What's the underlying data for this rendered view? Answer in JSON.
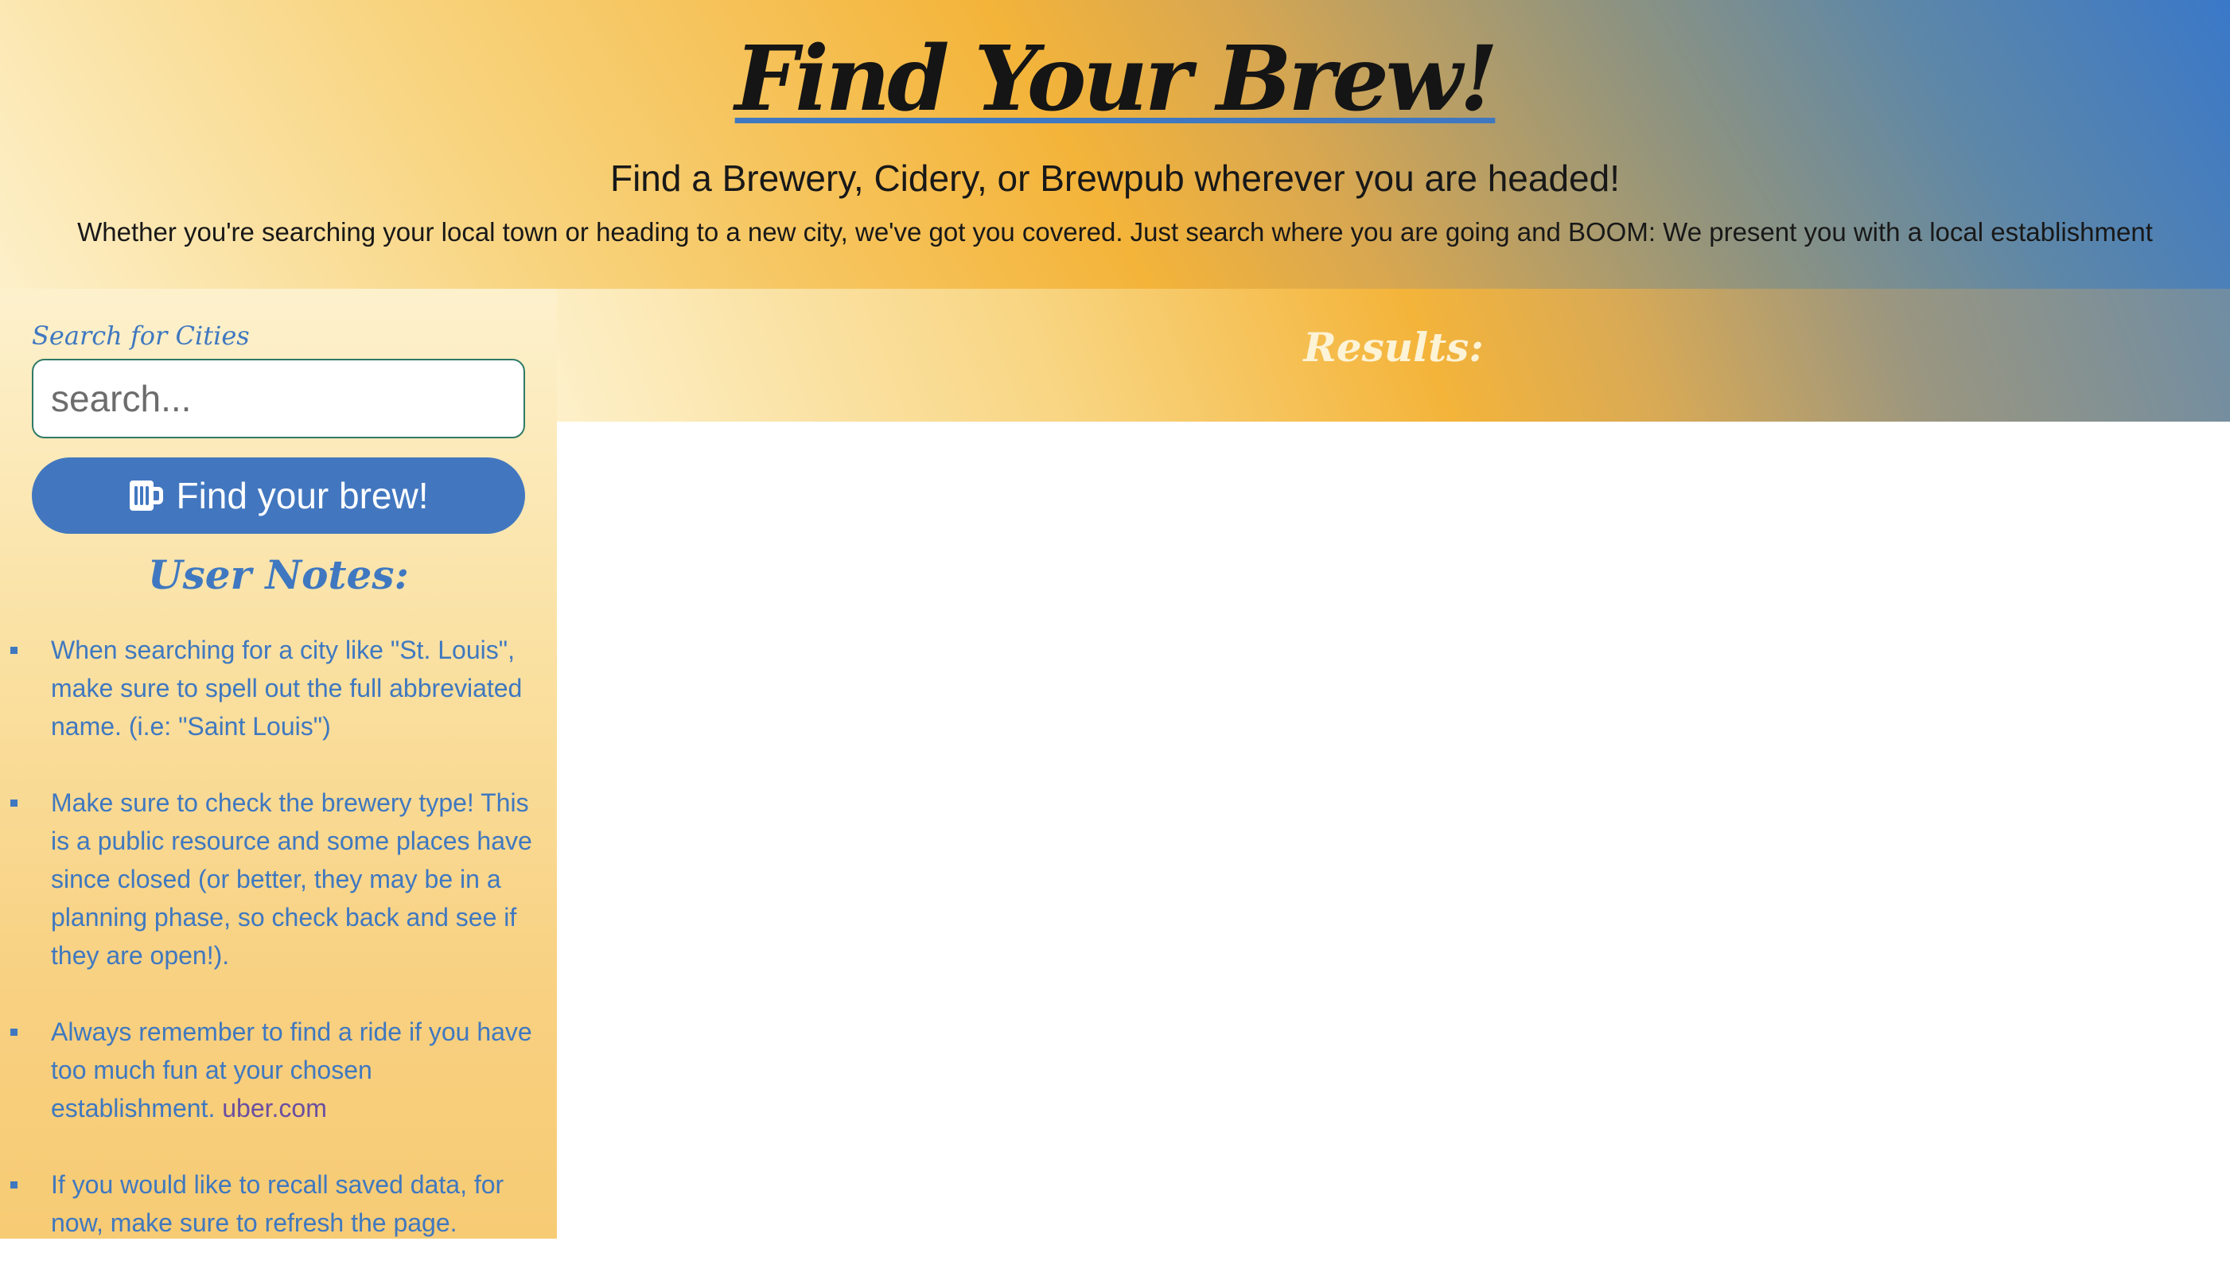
{
  "header": {
    "title": "Find Your Brew!",
    "subtitle": "Find a Brewery, Cidery, or Brewpub wherever you are headed!",
    "tagline": "Whether you're searching your local town or heading to a new city, we've got you covered. Just search where you are going and BOOM: We present you with a local establishment"
  },
  "sidebar": {
    "search_label": "Search for Cities",
    "search_placeholder": "search...",
    "search_value": "",
    "button_label": "Find your brew!",
    "button_icon": "beer-mug-icon",
    "notes_title": "User Notes:",
    "notes": [
      {
        "text": "When searching for a city like \"St. Louis\", make sure to spell out the full abbreviated name. (i.e: \"Saint Louis\")"
      },
      {
        "text": "Make sure to check the brewery type! This is a public resource and some places have since closed (or better, they may be in a planning phase, so check back and see if they are open!)."
      },
      {
        "text": "Always remember to find a ride if you have too much fun at your chosen establishment.",
        "link": "uber.com"
      },
      {
        "text": "If you would like to recall saved data, for now, make sure to refresh the page."
      }
    ]
  },
  "results": {
    "title": "Results:"
  },
  "colors": {
    "accent_blue": "#4277c0",
    "gold": "#f4b43a",
    "cream": "#fdf0c9"
  }
}
